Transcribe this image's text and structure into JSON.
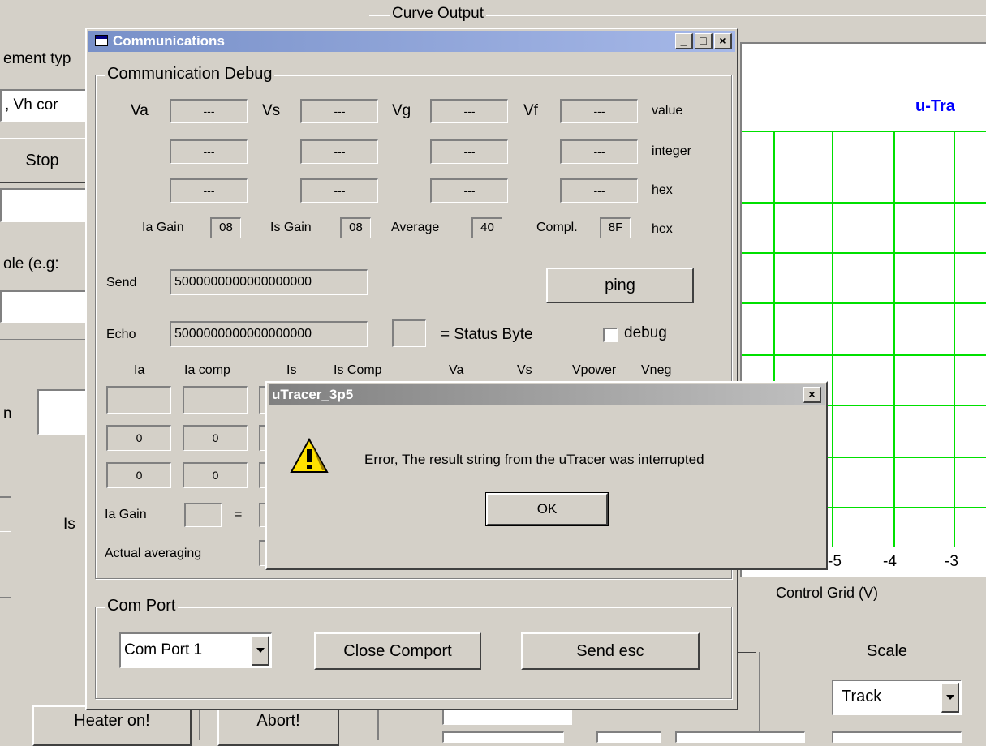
{
  "background": {
    "curve_output_title": "Curve Output",
    "left_labels": {
      "element_type": "ement typ",
      "vh_combo": ", Vh cor",
      "stop_button": "Stop",
      "example_label": "ole (e.g:",
      "n_label": "n",
      "is_label": "Is"
    },
    "plot": {
      "title": "u-Tra",
      "x_axis_label": "Control Grid (V)",
      "x_ticks": [
        "-5",
        "-4",
        "-3"
      ],
      "grid_color": "#00e000",
      "title_color": "#0000ff"
    },
    "scale_label": "Scale",
    "scale_combo_value": "Track",
    "bottom_buttons": {
      "heater": "Heater on!",
      "abort": "Abort!"
    }
  },
  "comm_window": {
    "title": "Communications",
    "debug_group": "Communication Debug",
    "voltage_labels": [
      "Va",
      "Vs",
      "Vg",
      "Vf"
    ],
    "value_rows": [
      {
        "cells": [
          "---",
          "---",
          "---",
          "---"
        ],
        "label": "value"
      },
      {
        "cells": [
          "---",
          "---",
          "---",
          "---"
        ],
        "label": "integer"
      },
      {
        "cells": [
          "---",
          "---",
          "---",
          "---"
        ],
        "label": "hex"
      }
    ],
    "gains": {
      "ia_gain_label": "Ia Gain",
      "ia_gain": "08",
      "is_gain_label": "Is Gain",
      "is_gain": "08",
      "average_label": "Average",
      "average": "40",
      "compl_label": "Compl.",
      "compl": "8F",
      "unit": "hex"
    },
    "send_label": "Send",
    "send_value": "5000000000000000000",
    "ping_button": "ping",
    "echo_label": "Echo",
    "echo_value": "5000000000000000000",
    "status_byte_label": "= Status Byte",
    "debug_checkbox_label": "debug",
    "columns": [
      "Ia",
      "Ia comp",
      "Is",
      "Is Comp",
      "Va",
      "Vs",
      "Vpower",
      "Vneg"
    ],
    "row1": [
      "",
      ""
    ],
    "row2": [
      "0",
      "0"
    ],
    "row3": [
      "0",
      "0"
    ],
    "ia_gain_row_label": "Ia Gain",
    "equals": "=",
    "actual_averaging_label": "Actual averaging",
    "com_port_group": "Com Port",
    "com_port_value": "Com Port 1",
    "close_comport_button": "Close Comport",
    "send_esc_button": "Send esc"
  },
  "error_dialog": {
    "title": "uTracer_3p5",
    "message": "Error, The result string from the uTracer was interrupted",
    "ok_button": "OK"
  }
}
